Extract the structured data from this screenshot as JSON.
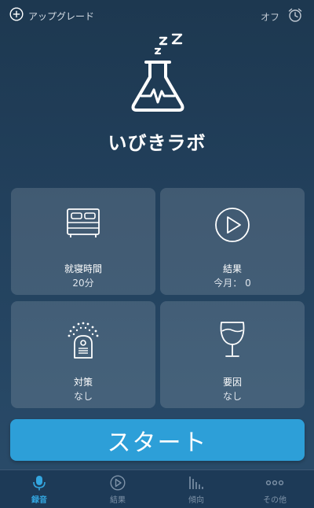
{
  "header": {
    "upgrade_label": "アップグレード",
    "alarm_status": "オフ"
  },
  "app_title": "いびきラボ",
  "tiles": [
    {
      "name": "就寝時間",
      "value": "20分",
      "icon": "bed-icon"
    },
    {
      "name": "結果",
      "value": "今月： 0",
      "icon": "play-circle-icon"
    },
    {
      "name": "対策",
      "value": "なし",
      "icon": "remedy-device-icon"
    },
    {
      "name": "要因",
      "value": "なし",
      "icon": "wine-glass-icon"
    }
  ],
  "start_label": "スタート",
  "tabs": [
    {
      "label": "録音",
      "icon": "microphone-icon",
      "active": true
    },
    {
      "label": "結果",
      "icon": "play-circle-icon"
    },
    {
      "label": "傾向",
      "icon": "bar-chart-icon"
    },
    {
      "label": "その他",
      "icon": "more-dots-icon"
    }
  ],
  "colors": {
    "accent": "#2d9fd8",
    "active_tab": "#33a6e0",
    "inactive_tab": "#7f93a8",
    "background_top": "#1d3850",
    "background_bottom": "#2a4c6a"
  }
}
